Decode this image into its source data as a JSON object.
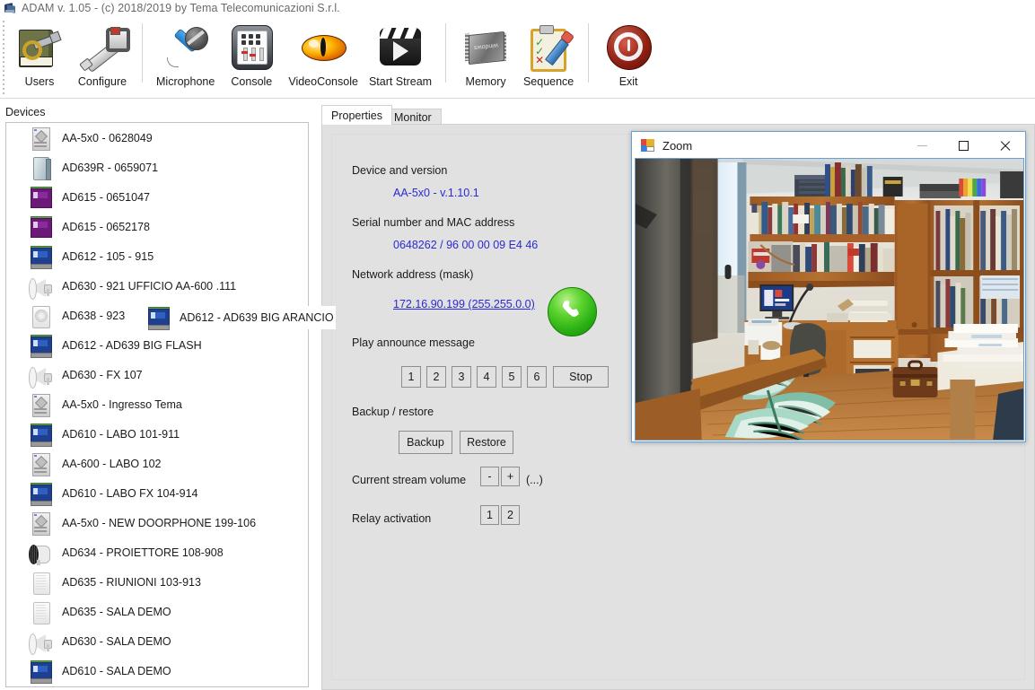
{
  "window": {
    "title": "ADAM v. 1.05 - (c) 2018/2019 by Tema Telecomunicazioni S.r.l.",
    "icon": "adam-app-icon"
  },
  "toolbar": {
    "items": [
      {
        "label": "Users",
        "icon": "users-book-key-icon"
      },
      {
        "label": "Configure",
        "icon": "wrench-icon"
      },
      {
        "label": "Microphone",
        "icon": "microphone-icon"
      },
      {
        "label": "Console",
        "icon": "console-mixer-icon"
      },
      {
        "label": "VideoConsole",
        "icon": "eye-icon"
      },
      {
        "label": "Start Stream",
        "icon": "clapperboard-play-icon"
      },
      {
        "label": "Memory",
        "icon": "memory-chip-icon"
      },
      {
        "label": "Sequence",
        "icon": "clipboard-pencil-icon"
      },
      {
        "label": "Exit",
        "icon": "power-off-icon"
      }
    ]
  },
  "devices": {
    "header": "Devices",
    "items": [
      {
        "label": "AA-5x0 - 0628049",
        "icon": "rack-unit-icon"
      },
      {
        "label": "AD639R - 0659071",
        "icon": "cabinet-icon"
      },
      {
        "label": "AD615 - 0651047",
        "icon": "module-purple-icon"
      },
      {
        "label": "AD615 - 0652178",
        "icon": "module-purple-icon"
      },
      {
        "label": "AD612 - 105 - 915",
        "icon": "module-blue-icon"
      },
      {
        "label": "AD630 - 921 UFFICIO AA-600 .111",
        "icon": "horn-speaker-icon"
      },
      {
        "label": "AD638 - 923",
        "icon": "box-speaker-icon"
      },
      {
        "label": "AD612 - AD639 BIG FLASH",
        "icon": "module-blue-icon"
      },
      {
        "label": "AD630 - FX 107",
        "icon": "horn-speaker-icon"
      },
      {
        "label": "AA-5x0 - Ingresso Tema",
        "icon": "rack-unit-icon"
      },
      {
        "label": "AD610 - LABO 101-911",
        "icon": "module-blue-icon"
      },
      {
        "label": "AA-600 - LABO 102",
        "icon": "rack-unit-icon"
      },
      {
        "label": "AD610 - LABO FX 104-914",
        "icon": "module-blue-icon"
      },
      {
        "label": "AA-5x0 - NEW DOORPHONE 199-106",
        "icon": "rack-unit-icon"
      },
      {
        "label": "AD634 - PROIETTORE 108-908",
        "icon": "projector-speaker-icon"
      },
      {
        "label": "AD635 - RIUNIONI 103-913",
        "icon": "wall-speaker-icon"
      },
      {
        "label": "AD635 - SALA DEMO",
        "icon": "wall-speaker-icon"
      },
      {
        "label": "AD630 - SALA DEMO",
        "icon": "horn-speaker-icon"
      },
      {
        "label": "AD610 - SALA DEMO",
        "icon": "module-blue-icon"
      }
    ],
    "dragged_item": {
      "label": "AD612 - AD639 BIG ARANCIO",
      "icon": "module-blue-icon"
    }
  },
  "tabs": [
    {
      "label": "Properties",
      "active": true
    },
    {
      "label": "Monitor",
      "active": false
    }
  ],
  "properties": {
    "device_version_label": "Device and version",
    "device_version_value": "AA-5x0 - v.1.10.1",
    "serial_mac_label": "Serial number and MAC address",
    "serial_mac_value": "0648262 / 96 00 00 09 E4 46",
    "network_label": "Network address (mask)",
    "network_value": "172.16.90.199 (255.255.0.0)",
    "call_button_icon": "phone-handset-icon",
    "announce_label": "Play announce message",
    "announce_buttons": [
      "1",
      "2",
      "3",
      "4",
      "5",
      "6"
    ],
    "stop_label": "Stop",
    "backup_label": "Backup / restore",
    "backup_button": "Backup",
    "restore_button": "Restore",
    "volume_label": "Current stream volume",
    "volume_minus": "-",
    "volume_plus": "+",
    "volume_extra": "(...)",
    "relay_label": "Relay activation",
    "relay_buttons": [
      "1",
      "2"
    ]
  },
  "zoom_window": {
    "title": "Zoom",
    "icon": "zoom-window-icon",
    "minimize": "minimize-icon",
    "maximize": "maximize-icon",
    "close": "close-icon",
    "video_description": "Live camera view of an office with wooden bookshelves, a desk with a monitor and microphone, an office chair, a leather briefcase and a stack of papers"
  },
  "colors": {
    "link": "#2a2ad2",
    "panel_bg": "#e1e1e1",
    "accent_green": "#27ae12",
    "zoom_border": "#6b9fd0"
  }
}
